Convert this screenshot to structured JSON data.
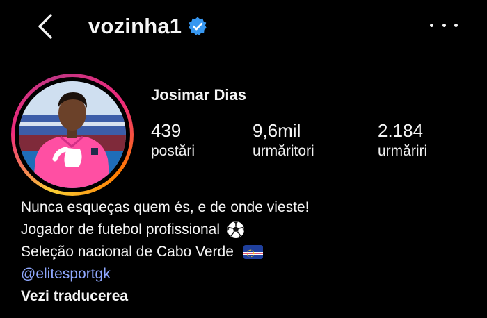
{
  "header": {
    "username": "vozinha1",
    "back_icon": "chevron-left-icon",
    "verified_icon": "verified-badge-icon",
    "more_icon": "more-horizontal-icon"
  },
  "profile": {
    "full_name": "Josimar Dias",
    "stats": {
      "posts": {
        "value": "439",
        "label": "postări"
      },
      "followers": {
        "value": "9,6mil",
        "label": "urmăritori"
      },
      "following": {
        "value": "2.184",
        "label": "urmăriri"
      }
    }
  },
  "bio": {
    "line1": "Nunca esqueças quem és, e de onde vieste!",
    "line2": "Jogador de futebol profissional",
    "line3": "Seleção nacional de Cabo Verde",
    "link": "@elitesportgk",
    "translate": "Vezi traducerea"
  },
  "colors": {
    "background": "#000000",
    "text": "#f5f5f5",
    "link": "#8fa8ff",
    "verified": "#3797f0"
  }
}
